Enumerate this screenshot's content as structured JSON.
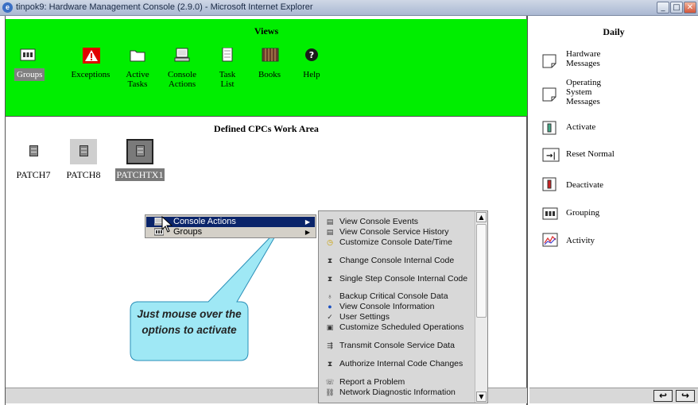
{
  "window": {
    "title": "tinpok9: Hardware Management Console (2.9.0) - Microsoft Internet Explorer",
    "minimize_label": "_",
    "maximize_label": "□",
    "close_label": "✕"
  },
  "views": {
    "heading": "Views",
    "tasks": [
      {
        "label": "Groups",
        "icon": "groups-icon"
      },
      {
        "label": "Exceptions",
        "icon": "exceptions-icon"
      },
      {
        "label": "Active Tasks",
        "icon": "active-tasks-icon"
      },
      {
        "label": "Console Actions",
        "icon": "console-actions-icon"
      },
      {
        "label": "Task List",
        "icon": "task-list-icon"
      },
      {
        "label": "Books",
        "icon": "books-icon"
      },
      {
        "label": "Help",
        "icon": "help-icon"
      }
    ],
    "colors": {
      "background": "#00ee00",
      "selected": "#808080"
    }
  },
  "work_area": {
    "heading": "Defined CPCs Work Area",
    "cpcs": [
      {
        "name": "PATCH7"
      },
      {
        "name": "PATCH8"
      },
      {
        "name": "PATCHTX1"
      }
    ]
  },
  "daily": {
    "heading": "Daily",
    "items": [
      {
        "label": "Hardware Messages",
        "icon": "hardware-messages-icon"
      },
      {
        "label": "Operating System Messages",
        "icon": "os-messages-icon"
      },
      {
        "label": "Activate",
        "icon": "activate-icon"
      },
      {
        "label": "Reset Normal",
        "icon": "reset-normal-icon"
      },
      {
        "label": "Deactivate",
        "icon": "deactivate-icon"
      },
      {
        "label": "Grouping",
        "icon": "grouping-icon"
      },
      {
        "label": "Activity",
        "icon": "activity-icon"
      }
    ]
  },
  "context_menu": {
    "items": [
      {
        "label": "Console Actions",
        "highlighted": true
      },
      {
        "label": "Groups",
        "highlighted": false
      }
    ]
  },
  "submenu": {
    "items": [
      "View Console Events",
      "View Console Service History",
      "Customize Console Date/Time",
      "Change Console Internal Code",
      "Single Step Console Internal Code",
      "Backup Critical Console Data",
      "View Console Information",
      "User Settings",
      "Customize Scheduled Operations",
      "Transmit Console Service Data",
      "Authorize Internal Code Changes",
      "Report a Problem",
      "Network Diagnostic Information"
    ]
  },
  "callout": {
    "text": "Just mouse over the options to activate",
    "color": "#9fe8f5"
  },
  "nav": {
    "back_label": "↩",
    "forward_label": "↪"
  }
}
